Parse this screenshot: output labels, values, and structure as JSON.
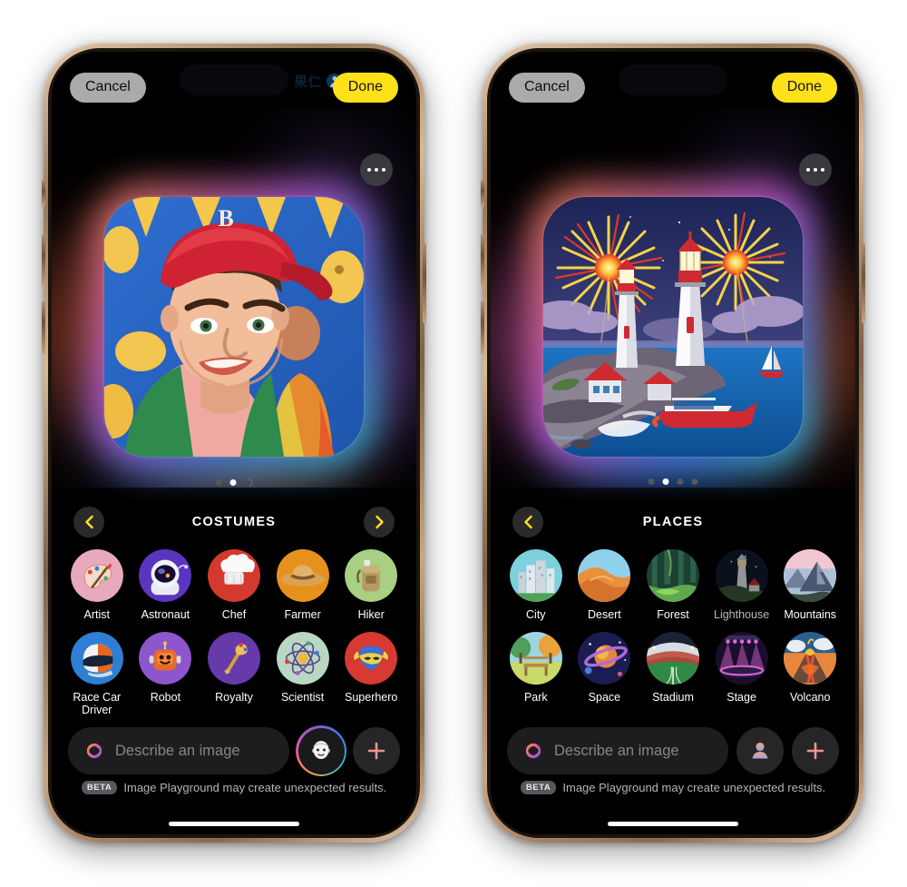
{
  "app": {
    "name": "Image Playground"
  },
  "phones": [
    {
      "id": "left",
      "status": {
        "island_text": "果仁"
      },
      "topbar": {
        "cancel_label": "Cancel",
        "done_label": "Done"
      },
      "canvas": {
        "more_icon": "ellipsis-icon",
        "artwork_name": "cartoon-portrait-baseball-cap",
        "artwork_alt": "Illustrated portrait of a young man in a red baseball cap with B logo",
        "page_dots": {
          "count": 3,
          "active_index": 1,
          "last_is_spinner": true
        }
      },
      "category": {
        "title": "COSTUMES",
        "prev_icon": "chevron-left-icon",
        "next_icon": "chevron-right-icon",
        "show_prev": true,
        "show_next": true
      },
      "items": [
        {
          "label": "Artist",
          "icon": "artist-palette-icon",
          "dim": false
        },
        {
          "label": "Astronaut",
          "icon": "astronaut-helmet-icon",
          "dim": false
        },
        {
          "label": "Chef",
          "icon": "chef-hat-icon",
          "dim": false
        },
        {
          "label": "Farmer",
          "icon": "farmer-hat-icon",
          "dim": false
        },
        {
          "label": "Hiker",
          "icon": "hiker-backpack-icon",
          "dim": false
        },
        {
          "label": "Race Car Driver",
          "icon": "racing-helmet-icon",
          "dim": false
        },
        {
          "label": "Robot",
          "icon": "robot-icon",
          "dim": false
        },
        {
          "label": "Royalty",
          "icon": "scepter-icon",
          "dim": false
        },
        {
          "label": "Scientist",
          "icon": "atom-icon",
          "dim": false
        },
        {
          "label": "Superhero",
          "icon": "superhero-mask-icon",
          "dim": false
        }
      ],
      "bottom": {
        "placeholder": "Describe an image",
        "leading_icon": "playground-atom-icon",
        "person_icon": "face-avatar-icon",
        "person_has_ring": true,
        "add_icon": "plus-icon",
        "beta_tag": "BETA",
        "beta_text": "Image Playground may create unexpected results."
      }
    },
    {
      "id": "right",
      "status": {
        "island_text": ""
      },
      "topbar": {
        "cancel_label": "Cancel",
        "done_label": "Done"
      },
      "canvas": {
        "more_icon": "ellipsis-icon",
        "artwork_name": "lighthouse-fireworks-scene",
        "artwork_alt": "Two lighthouses on a rocky coast with fireworks and boats",
        "page_dots": {
          "count": 4,
          "active_index": 1,
          "last_is_spinner": false
        }
      },
      "category": {
        "title": "PLACES",
        "prev_icon": "chevron-left-icon",
        "next_icon": "chevron-right-icon",
        "show_prev": true,
        "show_next": false
      },
      "items": [
        {
          "label": "City",
          "icon": "city-skyline-icon",
          "dim": false
        },
        {
          "label": "Desert",
          "icon": "desert-dune-icon",
          "dim": false
        },
        {
          "label": "Forest",
          "icon": "forest-icon",
          "dim": false
        },
        {
          "label": "Lighthouse",
          "icon": "lighthouse-icon",
          "dim": true
        },
        {
          "label": "Mountains",
          "icon": "mountains-icon",
          "dim": false
        },
        {
          "label": "Park",
          "icon": "park-bench-icon",
          "dim": false
        },
        {
          "label": "Space",
          "icon": "planet-icon",
          "dim": false
        },
        {
          "label": "Stadium",
          "icon": "stadium-icon",
          "dim": false
        },
        {
          "label": "Stage",
          "icon": "stage-lights-icon",
          "dim": false
        },
        {
          "label": "Volcano",
          "icon": "volcano-icon",
          "dim": false
        }
      ],
      "bottom": {
        "placeholder": "Describe an image",
        "leading_icon": "playground-atom-icon",
        "person_icon": "person-icon",
        "person_has_ring": false,
        "add_icon": "plus-icon",
        "beta_tag": "BETA",
        "beta_text": "Image Playground may create unexpected results."
      }
    }
  ],
  "colors": {
    "accent_yellow": "#ffe11a",
    "cancel_gray": "#aaaaaa",
    "screen_black": "#000000",
    "frame_gold": "#c6a382"
  }
}
